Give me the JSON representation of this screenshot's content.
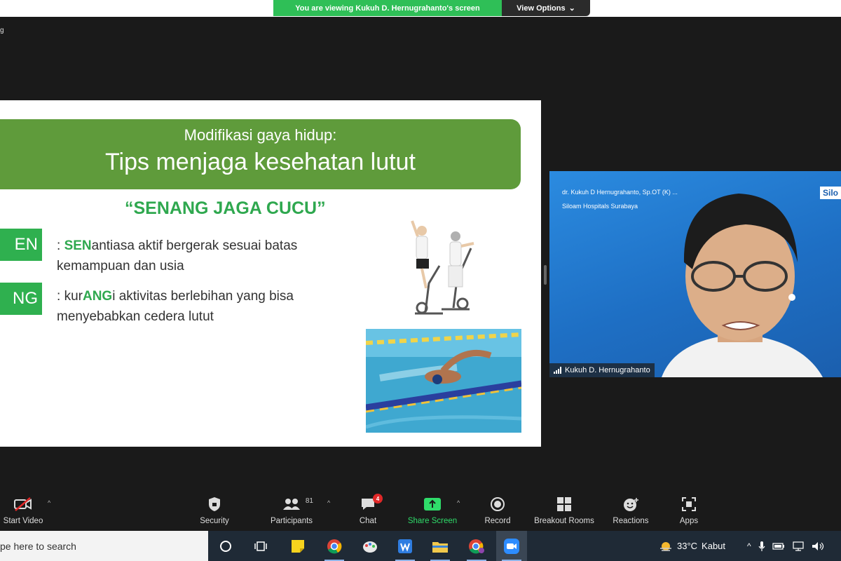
{
  "banner": {
    "viewing_text": "You are viewing Kukuh D. Hernugrahanto's screen",
    "view_options_label": "View Options",
    "corner_fragment": "g"
  },
  "slide": {
    "subtitle": "Modifikasi gaya hidup:",
    "title": "Tips menjaga kesehatan lutut",
    "slogan": "“SENANG JAGA CUCU”",
    "points": [
      {
        "tag": "EN",
        "highlight": "SEN",
        "rest_line1": "antiasa aktif bergerak sesuai batas",
        "line2": "kemampuan dan usia",
        "prefix": ": "
      },
      {
        "tag": "NG",
        "pre": "kur",
        "highlight": "ANG",
        "rest_line1": "i aktivitas berlebihan yang bisa",
        "line2": "menyebabkan cedera lutut",
        "prefix": ": "
      }
    ],
    "colors": {
      "header_bg": "#5f9b3b",
      "accent": "#2fa84f"
    }
  },
  "video": {
    "overlay_name": "dr. Kukuh D Hernugrahanto, Sp.OT (K) ...",
    "overlay_hospital": "Siloam Hospitals Surabaya",
    "logo_text": "Silo",
    "participant_name": "Kukuh D. Hernugrahanto"
  },
  "toolbar": {
    "start_video": "Start Video",
    "security": "Security",
    "participants": "Participants",
    "participants_count": "81",
    "chat": "Chat",
    "chat_badge": "4",
    "share_screen": "Share Screen",
    "record": "Record",
    "breakout_rooms": "Breakout Rooms",
    "reactions": "Reactions",
    "apps": "Apps",
    "share_color": "#2fdc6a"
  },
  "taskbar": {
    "search_placeholder": "pe here to search",
    "temperature": "33°C",
    "weather_text": "Kabut"
  }
}
